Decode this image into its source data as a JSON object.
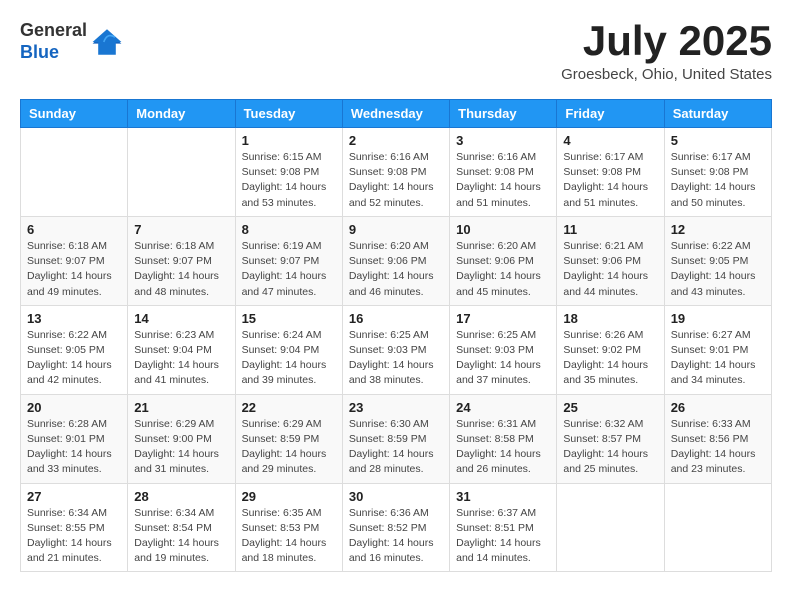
{
  "header": {
    "logo_line1": "General",
    "logo_line2": "Blue",
    "month_title": "July 2025",
    "location": "Groesbeck, Ohio, United States"
  },
  "days_of_week": [
    "Sunday",
    "Monday",
    "Tuesday",
    "Wednesday",
    "Thursday",
    "Friday",
    "Saturday"
  ],
  "weeks": [
    [
      {
        "day": "",
        "sunrise": "",
        "sunset": "",
        "daylight": ""
      },
      {
        "day": "",
        "sunrise": "",
        "sunset": "",
        "daylight": ""
      },
      {
        "day": "1",
        "sunrise": "Sunrise: 6:15 AM",
        "sunset": "Sunset: 9:08 PM",
        "daylight": "Daylight: 14 hours and 53 minutes."
      },
      {
        "day": "2",
        "sunrise": "Sunrise: 6:16 AM",
        "sunset": "Sunset: 9:08 PM",
        "daylight": "Daylight: 14 hours and 52 minutes."
      },
      {
        "day": "3",
        "sunrise": "Sunrise: 6:16 AM",
        "sunset": "Sunset: 9:08 PM",
        "daylight": "Daylight: 14 hours and 51 minutes."
      },
      {
        "day": "4",
        "sunrise": "Sunrise: 6:17 AM",
        "sunset": "Sunset: 9:08 PM",
        "daylight": "Daylight: 14 hours and 51 minutes."
      },
      {
        "day": "5",
        "sunrise": "Sunrise: 6:17 AM",
        "sunset": "Sunset: 9:08 PM",
        "daylight": "Daylight: 14 hours and 50 minutes."
      }
    ],
    [
      {
        "day": "6",
        "sunrise": "Sunrise: 6:18 AM",
        "sunset": "Sunset: 9:07 PM",
        "daylight": "Daylight: 14 hours and 49 minutes."
      },
      {
        "day": "7",
        "sunrise": "Sunrise: 6:18 AM",
        "sunset": "Sunset: 9:07 PM",
        "daylight": "Daylight: 14 hours and 48 minutes."
      },
      {
        "day": "8",
        "sunrise": "Sunrise: 6:19 AM",
        "sunset": "Sunset: 9:07 PM",
        "daylight": "Daylight: 14 hours and 47 minutes."
      },
      {
        "day": "9",
        "sunrise": "Sunrise: 6:20 AM",
        "sunset": "Sunset: 9:06 PM",
        "daylight": "Daylight: 14 hours and 46 minutes."
      },
      {
        "day": "10",
        "sunrise": "Sunrise: 6:20 AM",
        "sunset": "Sunset: 9:06 PM",
        "daylight": "Daylight: 14 hours and 45 minutes."
      },
      {
        "day": "11",
        "sunrise": "Sunrise: 6:21 AM",
        "sunset": "Sunset: 9:06 PM",
        "daylight": "Daylight: 14 hours and 44 minutes."
      },
      {
        "day": "12",
        "sunrise": "Sunrise: 6:22 AM",
        "sunset": "Sunset: 9:05 PM",
        "daylight": "Daylight: 14 hours and 43 minutes."
      }
    ],
    [
      {
        "day": "13",
        "sunrise": "Sunrise: 6:22 AM",
        "sunset": "Sunset: 9:05 PM",
        "daylight": "Daylight: 14 hours and 42 minutes."
      },
      {
        "day": "14",
        "sunrise": "Sunrise: 6:23 AM",
        "sunset": "Sunset: 9:04 PM",
        "daylight": "Daylight: 14 hours and 41 minutes."
      },
      {
        "day": "15",
        "sunrise": "Sunrise: 6:24 AM",
        "sunset": "Sunset: 9:04 PM",
        "daylight": "Daylight: 14 hours and 39 minutes."
      },
      {
        "day": "16",
        "sunrise": "Sunrise: 6:25 AM",
        "sunset": "Sunset: 9:03 PM",
        "daylight": "Daylight: 14 hours and 38 minutes."
      },
      {
        "day": "17",
        "sunrise": "Sunrise: 6:25 AM",
        "sunset": "Sunset: 9:03 PM",
        "daylight": "Daylight: 14 hours and 37 minutes."
      },
      {
        "day": "18",
        "sunrise": "Sunrise: 6:26 AM",
        "sunset": "Sunset: 9:02 PM",
        "daylight": "Daylight: 14 hours and 35 minutes."
      },
      {
        "day": "19",
        "sunrise": "Sunrise: 6:27 AM",
        "sunset": "Sunset: 9:01 PM",
        "daylight": "Daylight: 14 hours and 34 minutes."
      }
    ],
    [
      {
        "day": "20",
        "sunrise": "Sunrise: 6:28 AM",
        "sunset": "Sunset: 9:01 PM",
        "daylight": "Daylight: 14 hours and 33 minutes."
      },
      {
        "day": "21",
        "sunrise": "Sunrise: 6:29 AM",
        "sunset": "Sunset: 9:00 PM",
        "daylight": "Daylight: 14 hours and 31 minutes."
      },
      {
        "day": "22",
        "sunrise": "Sunrise: 6:29 AM",
        "sunset": "Sunset: 8:59 PM",
        "daylight": "Daylight: 14 hours and 29 minutes."
      },
      {
        "day": "23",
        "sunrise": "Sunrise: 6:30 AM",
        "sunset": "Sunset: 8:59 PM",
        "daylight": "Daylight: 14 hours and 28 minutes."
      },
      {
        "day": "24",
        "sunrise": "Sunrise: 6:31 AM",
        "sunset": "Sunset: 8:58 PM",
        "daylight": "Daylight: 14 hours and 26 minutes."
      },
      {
        "day": "25",
        "sunrise": "Sunrise: 6:32 AM",
        "sunset": "Sunset: 8:57 PM",
        "daylight": "Daylight: 14 hours and 25 minutes."
      },
      {
        "day": "26",
        "sunrise": "Sunrise: 6:33 AM",
        "sunset": "Sunset: 8:56 PM",
        "daylight": "Daylight: 14 hours and 23 minutes."
      }
    ],
    [
      {
        "day": "27",
        "sunrise": "Sunrise: 6:34 AM",
        "sunset": "Sunset: 8:55 PM",
        "daylight": "Daylight: 14 hours and 21 minutes."
      },
      {
        "day": "28",
        "sunrise": "Sunrise: 6:34 AM",
        "sunset": "Sunset: 8:54 PM",
        "daylight": "Daylight: 14 hours and 19 minutes."
      },
      {
        "day": "29",
        "sunrise": "Sunrise: 6:35 AM",
        "sunset": "Sunset: 8:53 PM",
        "daylight": "Daylight: 14 hours and 18 minutes."
      },
      {
        "day": "30",
        "sunrise": "Sunrise: 6:36 AM",
        "sunset": "Sunset: 8:52 PM",
        "daylight": "Daylight: 14 hours and 16 minutes."
      },
      {
        "day": "31",
        "sunrise": "Sunrise: 6:37 AM",
        "sunset": "Sunset: 8:51 PM",
        "daylight": "Daylight: 14 hours and 14 minutes."
      },
      {
        "day": "",
        "sunrise": "",
        "sunset": "",
        "daylight": ""
      },
      {
        "day": "",
        "sunrise": "",
        "sunset": "",
        "daylight": ""
      }
    ]
  ]
}
